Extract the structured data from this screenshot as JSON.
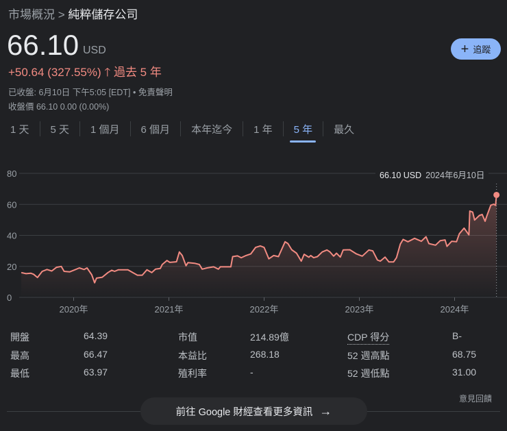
{
  "breadcrumb": {
    "parent": "市場概況",
    "sep": ">",
    "company": "純粹儲存公司"
  },
  "quote": {
    "price": "66.10",
    "currency": "USD",
    "change": "+50.64 (327.55%)",
    "period": "過去 5 年",
    "closed": "已收盤: 6月10日 下午5:05 [EDT] • 免責聲明",
    "close_price": "收盤價 66.10 0.00 (0.00%)"
  },
  "follow_label": "追蹤",
  "tabs": [
    {
      "label": "1 天"
    },
    {
      "label": "5 天"
    },
    {
      "label": "1 個月"
    },
    {
      "label": "6 個月"
    },
    {
      "label": "本年迄今"
    },
    {
      "label": "1 年"
    },
    {
      "label": "5 年"
    },
    {
      "label": "最久"
    }
  ],
  "selected_tab": "5 年",
  "tooltip": {
    "value": "66.10 USD",
    "date": "2024年6月10日"
  },
  "colors": {
    "line": "#f28b82",
    "accent": "#8ab4f8",
    "bg": "#202124"
  },
  "chart_data": {
    "type": "line",
    "title": "",
    "xlabel": "",
    "ylabel": "",
    "ylim": [
      0,
      80
    ],
    "xlim": [
      2019.45,
      2024.44
    ],
    "yticks": [
      0,
      20,
      40,
      60,
      80
    ],
    "xticks": [
      {
        "v": 2020,
        "label": "2020年"
      },
      {
        "v": 2021,
        "label": "2021年"
      },
      {
        "v": 2022,
        "label": "2022年"
      },
      {
        "v": 2023,
        "label": "2023年"
      },
      {
        "v": 2024,
        "label": "2024年"
      }
    ],
    "grid": true,
    "x": [
      2019.45,
      2019.5,
      2019.55,
      2019.58,
      2019.62,
      2019.67,
      2019.72,
      2019.77,
      2019.82,
      2019.87,
      2019.9,
      2019.96,
      2020.02,
      2020.06,
      2020.11,
      2020.14,
      2020.19,
      2020.22,
      2020.24,
      2020.3,
      2020.36,
      2020.4,
      2020.43,
      2020.47,
      2020.57,
      2020.62,
      2020.67,
      2020.72,
      2020.77,
      2020.82,
      2020.86,
      2020.91,
      2020.93,
      2020.98,
      2021.01,
      2021.08,
      2021.11,
      2021.14,
      2021.18,
      2021.2,
      2021.27,
      2021.32,
      2021.35,
      2021.4,
      2021.47,
      2021.52,
      2021.54,
      2021.61,
      2021.65,
      2021.67,
      2021.72,
      2021.76,
      2021.81,
      2021.86,
      2021.91,
      2021.96,
      2022.0,
      2022.05,
      2022.1,
      2022.15,
      2022.22,
      2022.25,
      2022.29,
      2022.34,
      2022.39,
      2022.42,
      2022.47,
      2022.49,
      2022.52,
      2022.56,
      2022.61,
      2022.66,
      2022.69,
      2022.73,
      2022.76,
      2022.8,
      2022.83,
      2022.9,
      2022.97,
      2023.03,
      2023.1,
      2023.14,
      2023.19,
      2023.22,
      2023.27,
      2023.31,
      2023.36,
      2023.39,
      2023.43,
      2023.46,
      2023.51,
      2023.58,
      2023.65,
      2023.7,
      2023.73,
      2023.8,
      2023.85,
      2023.9,
      2023.92,
      2023.97,
      2024.02,
      2024.05,
      2024.1,
      2024.15,
      2024.16,
      2024.19,
      2024.21,
      2024.26,
      2024.29,
      2024.32,
      2024.34,
      2024.38,
      2024.41,
      2024.43,
      2024.44
    ],
    "values": [
      16,
      15.3,
      15.6,
      14.9,
      12.8,
      16.8,
      18,
      17,
      19.4,
      20,
      16.8,
      16.5,
      18,
      19,
      18,
      19,
      14.6,
      9.4,
      12.4,
      13,
      16,
      17.5,
      16.8,
      17.8,
      17.8,
      16,
      14.3,
      14.3,
      17.8,
      16,
      18.2,
      18.7,
      21.2,
      23.8,
      22.6,
      23,
      29.3,
      27,
      20.4,
      22.4,
      22,
      21.2,
      18.2,
      19,
      19.7,
      18.2,
      19.7,
      19.7,
      19.7,
      26.3,
      26.8,
      25.6,
      27,
      28,
      32.2,
      33.2,
      32.2,
      24.9,
      27,
      26.3,
      35.9,
      34.7,
      30.7,
      28.5,
      23.4,
      27.8,
      25.9,
      27,
      25.6,
      26.3,
      29.3,
      30.6,
      29.4,
      26.6,
      28.5,
      26,
      30.6,
      30.7,
      28,
      26.6,
      30.6,
      30,
      24.1,
      23.4,
      26,
      22.9,
      22.9,
      25.6,
      34.4,
      37.4,
      35.9,
      38.1,
      36.2,
      39.1,
      34.7,
      33.7,
      36.6,
      37.1,
      32.9,
      36.2,
      35.9,
      41,
      44.7,
      40.3,
      55.7,
      55,
      49.9,
      52.8,
      53.5,
      49.1,
      52.8,
      59.4,
      60.1,
      59.4,
      66.1
    ]
  },
  "stats": [
    [
      {
        "label": "開盤",
        "value": "64.39"
      },
      {
        "label": "市值",
        "value": "214.89億"
      },
      {
        "label": "CDP 得分",
        "value": "B-"
      }
    ],
    [
      {
        "label": "最高",
        "value": "66.47"
      },
      {
        "label": "本益比",
        "value": "268.18"
      },
      {
        "label": "52 週高點",
        "value": "68.75"
      }
    ],
    [
      {
        "label": "最低",
        "value": "63.97"
      },
      {
        "label": "殖利率",
        "value": "-"
      },
      {
        "label": "52 週低點",
        "value": "31.00"
      }
    ]
  ],
  "feedback": "意見回饋",
  "more_button": "前往 Google 財經查看更多資訊"
}
